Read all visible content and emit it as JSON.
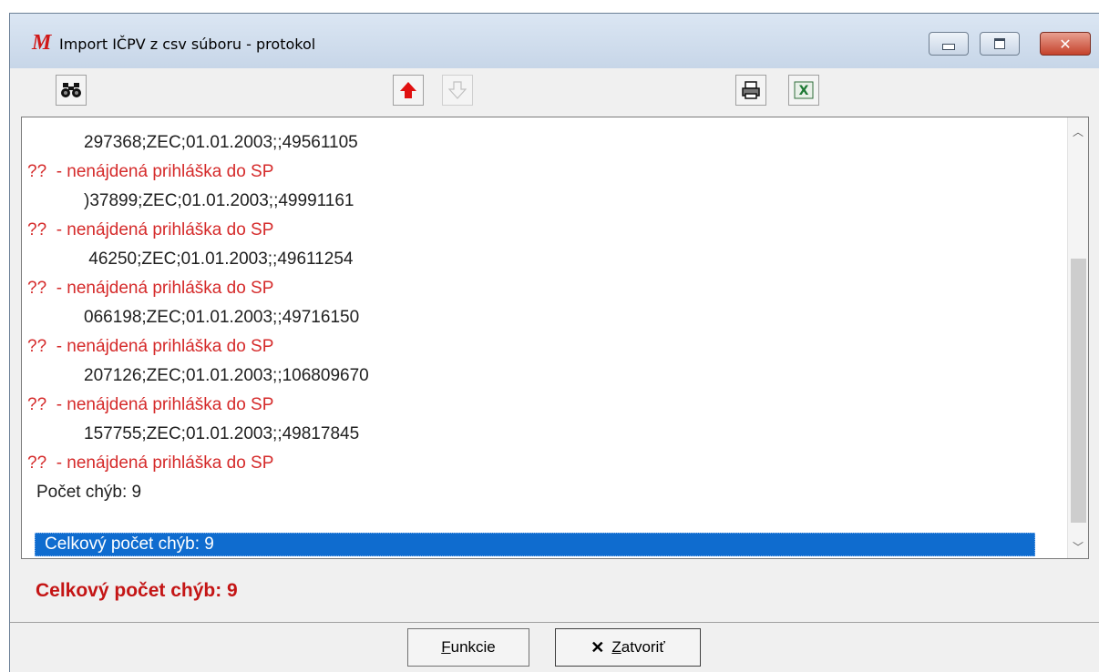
{
  "window": {
    "title": "Import IČPV z csv súboru - protokol",
    "app_icon_letter": "M"
  },
  "toolbar": {
    "find_icon": "binoculars-icon",
    "up_icon": "arrow-up-icon",
    "down_icon": "arrow-down-icon",
    "print_icon": "printer-icon",
    "excel_icon": "excel-export-icon"
  },
  "log": {
    "lines": [
      {
        "type": "data",
        "text": "297368;ZEC;01.01.2003;;49561105"
      },
      {
        "type": "err",
        "text": "??  - nenájdená prihláška do SP"
      },
      {
        "type": "data",
        "text": ")37899;ZEC;01.01.2003;;49991161"
      },
      {
        "type": "err",
        "text": "??  - nenájdená prihláška do SP"
      },
      {
        "type": "data",
        "text": " 46250;ZEC;01.01.2003;;49611254"
      },
      {
        "type": "err",
        "text": "??  - nenájdená prihláška do SP"
      },
      {
        "type": "data",
        "text": "066198;ZEC;01.01.2003;;49716150"
      },
      {
        "type": "err",
        "text": "??  - nenájdená prihláška do SP"
      },
      {
        "type": "data",
        "text": "207126;ZEC;01.01.2003;;106809670"
      },
      {
        "type": "err",
        "text": "??  - nenájdená prihláška do SP"
      },
      {
        "type": "data",
        "text": "157755;ZEC;01.01.2003;;49817845"
      },
      {
        "type": "err",
        "text": "??  - nenájdená prihláška do SP"
      },
      {
        "type": "summary",
        "text": "Počet chýb: 9"
      }
    ],
    "selected_text": "Celkový počet chýb: 9"
  },
  "status": {
    "text": "Celkový počet chýb: 9"
  },
  "buttons": {
    "funkcie_first": "F",
    "funkcie_rest": "unkcie",
    "zatvorit_first": "Z",
    "zatvorit_rest": "atvoriť"
  },
  "colors": {
    "error_text": "#d52a2a",
    "status_text": "#c41515",
    "selection": "#0f6ccf"
  }
}
